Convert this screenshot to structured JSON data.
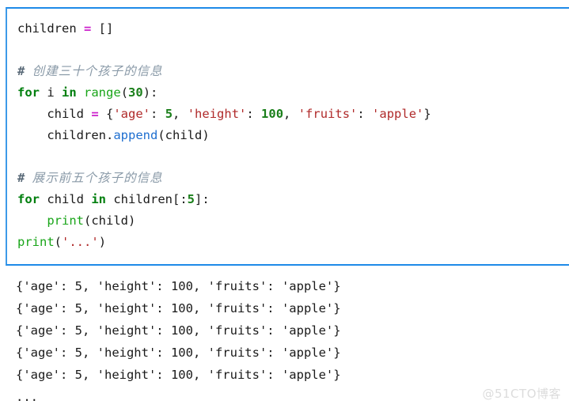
{
  "code_block": {
    "border_color": "#1e8ae8",
    "background": "#ffffff",
    "lines": [
      {
        "id": "l1",
        "type": "code",
        "tokens": [
          {
            "t": "children ",
            "c": "plain"
          },
          {
            "t": "=",
            "c": "op"
          },
          {
            "t": " []",
            "c": "plain"
          }
        ]
      },
      {
        "id": "l2",
        "type": "blank",
        "tokens": []
      },
      {
        "id": "l3",
        "type": "comment",
        "tokens": [
          {
            "t": "# ",
            "c": "hash"
          },
          {
            "t": "创建三十个孩子的信息",
            "c": "cn"
          }
        ]
      },
      {
        "id": "l4",
        "type": "code",
        "tokens": [
          {
            "t": "for",
            "c": "kw"
          },
          {
            "t": " i ",
            "c": "plain"
          },
          {
            "t": "in",
            "c": "kw"
          },
          {
            "t": " ",
            "c": "plain"
          },
          {
            "t": "range",
            "c": "builtin"
          },
          {
            "t": "(",
            "c": "plain"
          },
          {
            "t": "30",
            "c": "num"
          },
          {
            "t": "):",
            "c": "plain"
          }
        ]
      },
      {
        "id": "l5",
        "type": "code",
        "tokens": [
          {
            "t": "    child ",
            "c": "plain"
          },
          {
            "t": "=",
            "c": "op"
          },
          {
            "t": " {",
            "c": "plain"
          },
          {
            "t": "'age'",
            "c": "str"
          },
          {
            "t": ": ",
            "c": "plain"
          },
          {
            "t": "5",
            "c": "num"
          },
          {
            "t": ", ",
            "c": "plain"
          },
          {
            "t": "'height'",
            "c": "str"
          },
          {
            "t": ": ",
            "c": "plain"
          },
          {
            "t": "100",
            "c": "num"
          },
          {
            "t": ", ",
            "c": "plain"
          },
          {
            "t": "'fruits'",
            "c": "str"
          },
          {
            "t": ": ",
            "c": "plain"
          },
          {
            "t": "'apple'",
            "c": "str"
          },
          {
            "t": "}",
            "c": "plain"
          }
        ]
      },
      {
        "id": "l6",
        "type": "code",
        "tokens": [
          {
            "t": "    children.",
            "c": "plain"
          },
          {
            "t": "append",
            "c": "func"
          },
          {
            "t": "(child)",
            "c": "plain"
          }
        ]
      },
      {
        "id": "l7",
        "type": "blank",
        "tokens": []
      },
      {
        "id": "l8",
        "type": "comment",
        "tokens": [
          {
            "t": "# ",
            "c": "hash"
          },
          {
            "t": "展示前五个孩子的信息",
            "c": "cn"
          }
        ]
      },
      {
        "id": "l9",
        "type": "code",
        "tokens": [
          {
            "t": "for",
            "c": "kw"
          },
          {
            "t": " child ",
            "c": "plain"
          },
          {
            "t": "in",
            "c": "kw"
          },
          {
            "t": " children[:",
            "c": "plain"
          },
          {
            "t": "5",
            "c": "num"
          },
          {
            "t": "]:",
            "c": "plain"
          }
        ]
      },
      {
        "id": "l10",
        "type": "code",
        "tokens": [
          {
            "t": "    ",
            "c": "plain"
          },
          {
            "t": "print",
            "c": "builtin"
          },
          {
            "t": "(child)",
            "c": "plain"
          }
        ]
      },
      {
        "id": "l11",
        "type": "code",
        "tokens": [
          {
            "t": "print",
            "c": "builtin"
          },
          {
            "t": "(",
            "c": "plain"
          },
          {
            "t": "'...'",
            "c": "str"
          },
          {
            "t": ")",
            "c": "plain"
          }
        ]
      }
    ]
  },
  "output_block": {
    "lines": [
      "{'age': 5, 'height': 100, 'fruits': 'apple'}",
      "{'age': 5, 'height': 100, 'fruits': 'apple'}",
      "{'age': 5, 'height': 100, 'fruits': 'apple'}",
      "{'age': 5, 'height': 100, 'fruits': 'apple'}",
      "{'age': 5, 'height': 100, 'fruits': 'apple'}",
      "..."
    ]
  },
  "watermark": {
    "text": "@51CTO博客",
    "color": "#dcdcdc"
  }
}
